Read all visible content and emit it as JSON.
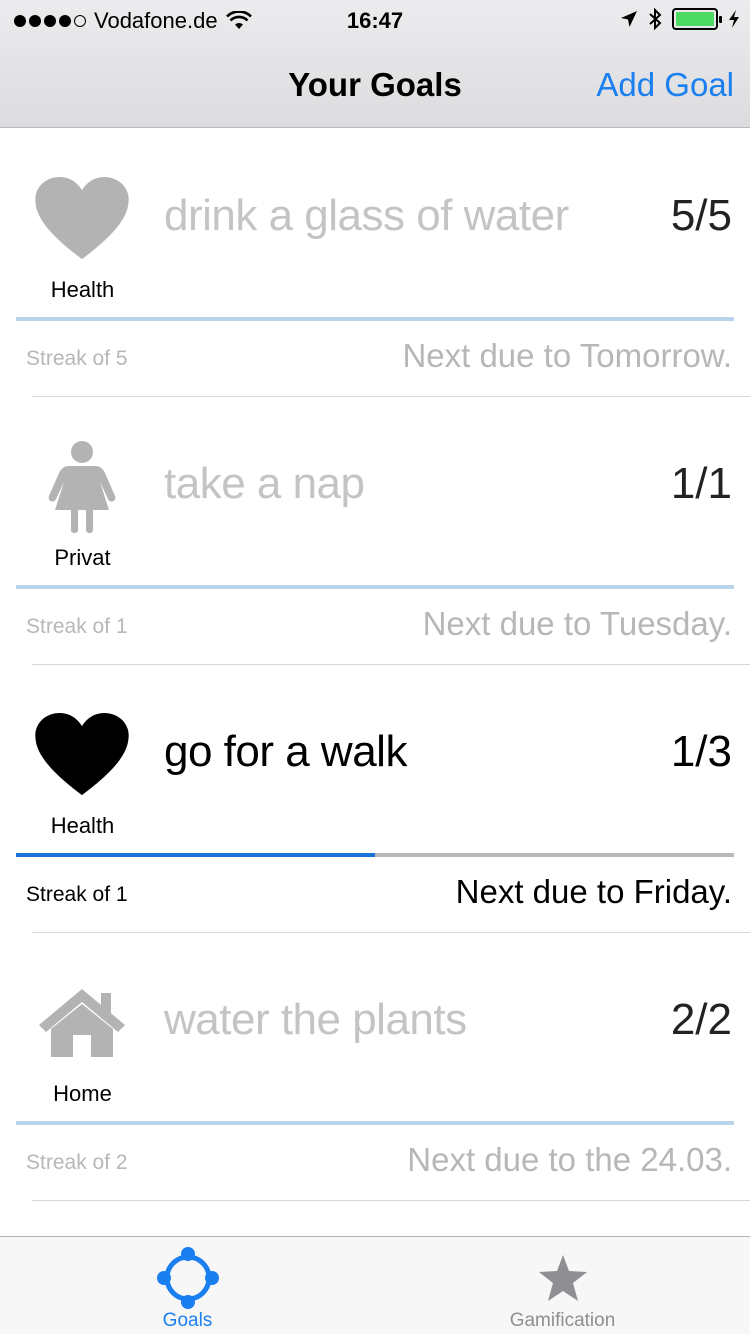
{
  "status_bar": {
    "carrier": "Vodafone.de",
    "time": "16:47",
    "signal_bars": 4,
    "battery_level": 1.0,
    "icons": [
      "wifi-icon",
      "location-arrow-icon",
      "bluetooth-icon",
      "battery-icon",
      "charging-icon"
    ]
  },
  "nav": {
    "title": "Your Goals",
    "add_goal_label": "Add Goal"
  },
  "colors": {
    "accent": "#1a7ff0",
    "progress_fill": "#1a73d9",
    "progress_track_done": "#b9d4ec",
    "muted_text": "#b7b7b9"
  },
  "goals": [
    {
      "category": "Health",
      "icon": "heart-icon",
      "title": "drink a glass of water",
      "count": "5/5",
      "progress": 1.0,
      "streak": "Streak of 5",
      "due": "Next due to Tomorrow.",
      "state": "done"
    },
    {
      "category": "Privat",
      "icon": "person-icon",
      "title": "take a nap",
      "count": "1/1",
      "progress": 1.0,
      "streak": "Streak of 1",
      "due": "Next due to Tuesday.",
      "state": "done"
    },
    {
      "category": "Health",
      "icon": "heart-icon",
      "title": "go for a walk",
      "count": "1/3",
      "progress": 0.5,
      "streak": "Streak of 1",
      "due": "Next due to Friday.",
      "state": "active"
    },
    {
      "category": "Home",
      "icon": "house-icon",
      "title": "water the plants",
      "count": "2/2",
      "progress": 1.0,
      "streak": "Streak of 2",
      "due": "Next due to the 24.03.",
      "state": "done"
    }
  ],
  "tabs": [
    {
      "label": "Goals",
      "icon": "crosshair-icon",
      "selected": true
    },
    {
      "label": "Gamification",
      "icon": "star-icon",
      "selected": false
    }
  ]
}
